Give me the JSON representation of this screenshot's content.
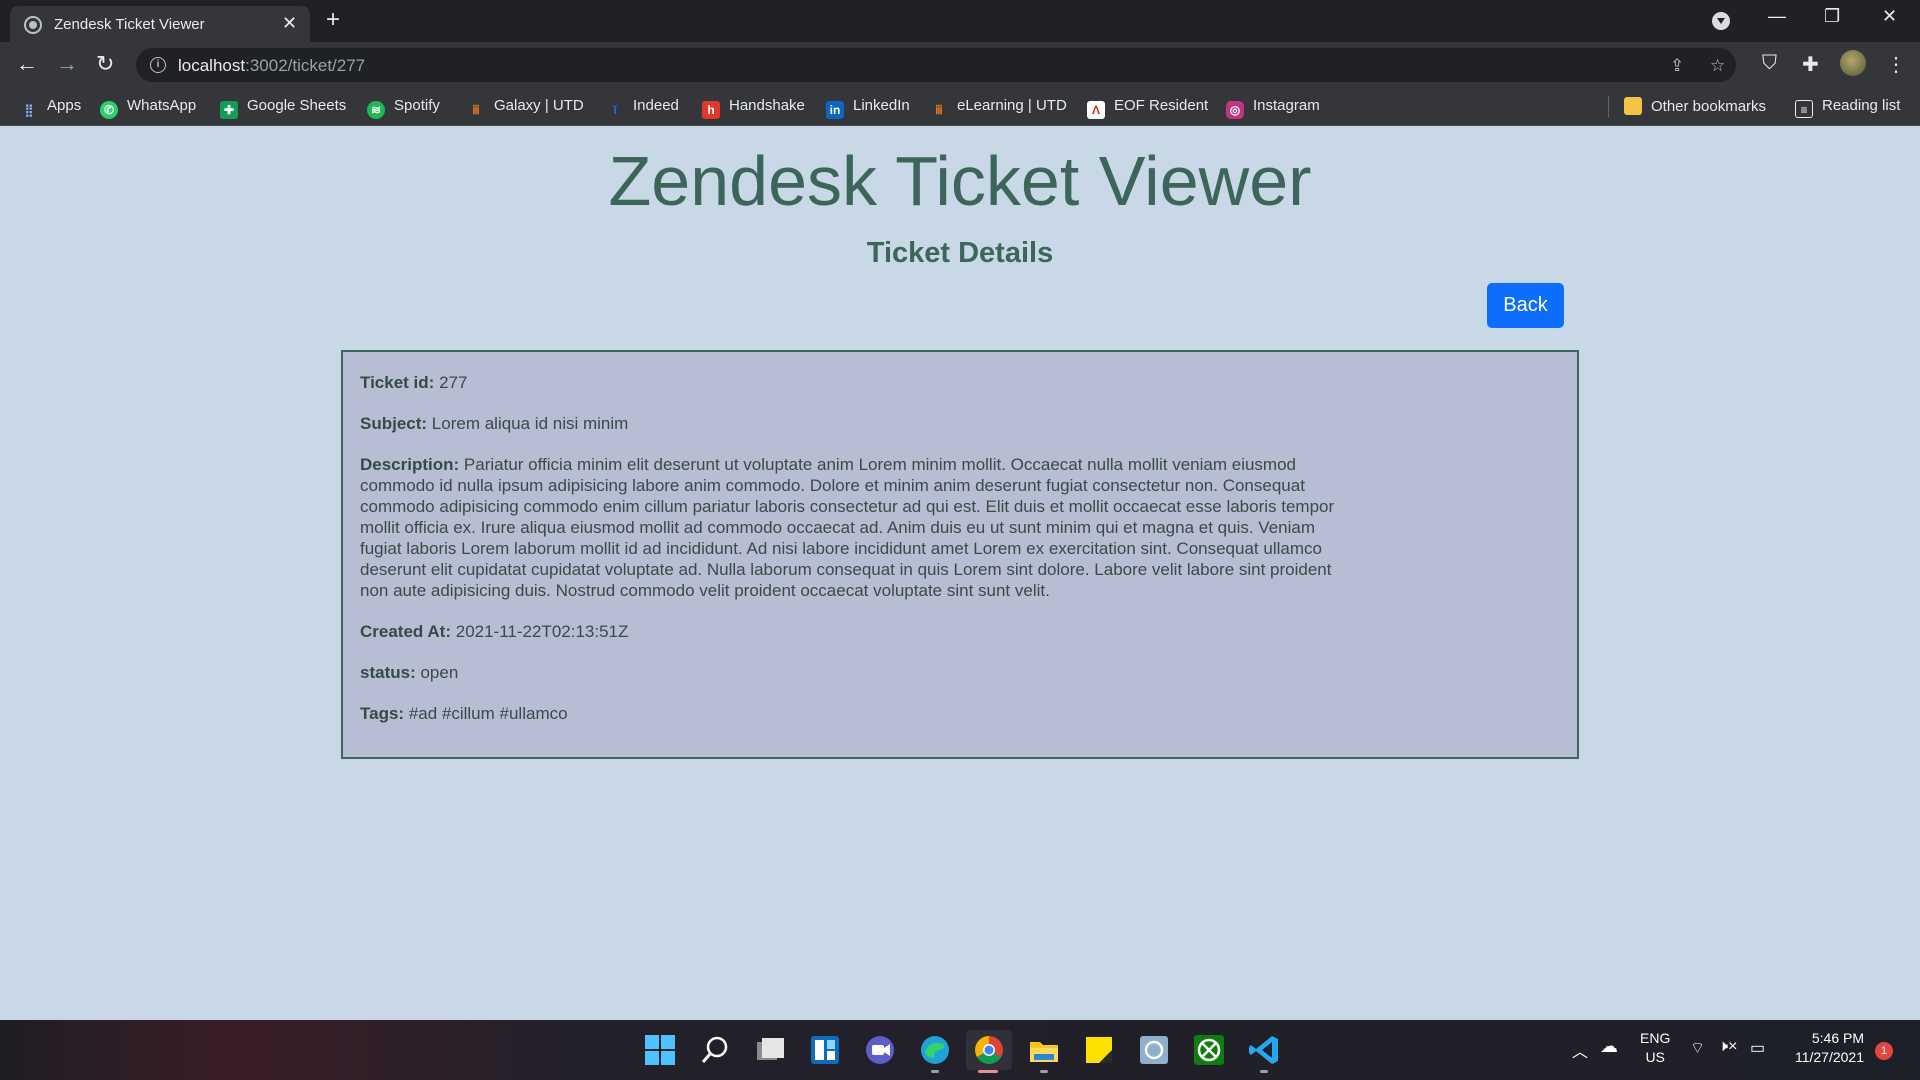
{
  "browser": {
    "tab_title": "Zendesk Ticket Viewer",
    "url_host": "localhost",
    "url_path": ":3002/ticket/277",
    "bookmarks": [
      {
        "label": "Apps",
        "color": "#ea4335"
      },
      {
        "label": "WhatsApp",
        "color": "#25d366"
      },
      {
        "label": "Google Sheets",
        "color": "#0f9d58"
      },
      {
        "label": "Spotify",
        "color": "#1db954"
      },
      {
        "label": "Galaxy | UTD",
        "color": "#e87722"
      },
      {
        "label": "Indeed",
        "color": "#2164f3"
      },
      {
        "label": "Handshake",
        "color": "#e0392b"
      },
      {
        "label": "LinkedIn",
        "color": "#0a66c2"
      },
      {
        "label": "eLearning | UTD",
        "color": "#e87722"
      },
      {
        "label": "EOF Resident",
        "color": "#d93025"
      },
      {
        "label": "Instagram",
        "color": "#c13584"
      }
    ],
    "other_bookmarks": "Other bookmarks",
    "reading_list": "Reading list"
  },
  "page": {
    "title": "Zendesk Ticket Viewer",
    "subtitle": "Ticket Details",
    "back_label": "Back"
  },
  "ticket": {
    "id_label": "Ticket id:",
    "id": "277",
    "subject_label": "Subject:",
    "subject": "Lorem aliqua id nisi minim",
    "description_label": "Description:",
    "description": "Pariatur officia minim elit deserunt ut voluptate anim Lorem minim mollit. Occaecat nulla mollit veniam eiusmod commodo id nulla ipsum adipisicing labore anim commodo. Dolore et minim anim deserunt fugiat consectetur non. Consequat commodo adipisicing commodo enim cillum pariatur laboris consectetur ad qui est. Elit duis et mollit occaecat esse laboris tempor mollit officia ex. Irure aliqua eiusmod mollit ad commodo occaecat ad. Anim duis eu ut sunt minim qui et magna et quis. Veniam fugiat laboris Lorem laborum mollit id ad incididunt. Ad nisi labore incididunt amet Lorem ex exercitation sint. Consequat ullamco deserunt elit cupidatat cupidatat voluptate ad. Nulla laborum consequat in quis Lorem sint dolore. Labore velit labore sint proident non aute adipisicing duis. Nostrud commodo velit proident occaecat voluptate sint sunt velit.",
    "created_label": "Created At:",
    "created": "2021-11-22T02:13:51Z",
    "status_label": "status:",
    "status": "open",
    "tags_label": "Tags:",
    "tags": "#ad #cillum #ullamco"
  },
  "taskbar": {
    "lang": "ENG",
    "region": "US",
    "time": "5:46 PM",
    "date": "11/27/2021",
    "notifications": "1"
  }
}
